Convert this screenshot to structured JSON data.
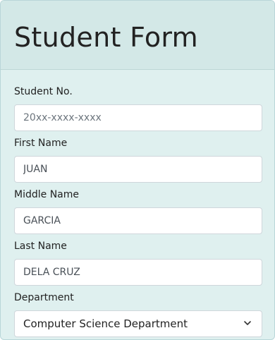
{
  "form": {
    "title": "Student Form",
    "fields": [
      {
        "label": "Student No.",
        "placeholder": "20xx-xxxx-xxxx",
        "value": ""
      },
      {
        "label": "First Name",
        "placeholder": "",
        "value": "JUAN"
      },
      {
        "label": "Middle Name",
        "placeholder": "",
        "value": "GARCIA"
      },
      {
        "label": "Last Name",
        "placeholder": "",
        "value": "DELA CRUZ"
      }
    ],
    "department": {
      "label": "Department",
      "selected": "Computer Science Department"
    }
  },
  "icons": {
    "department_select": "chevron-down-icon"
  }
}
